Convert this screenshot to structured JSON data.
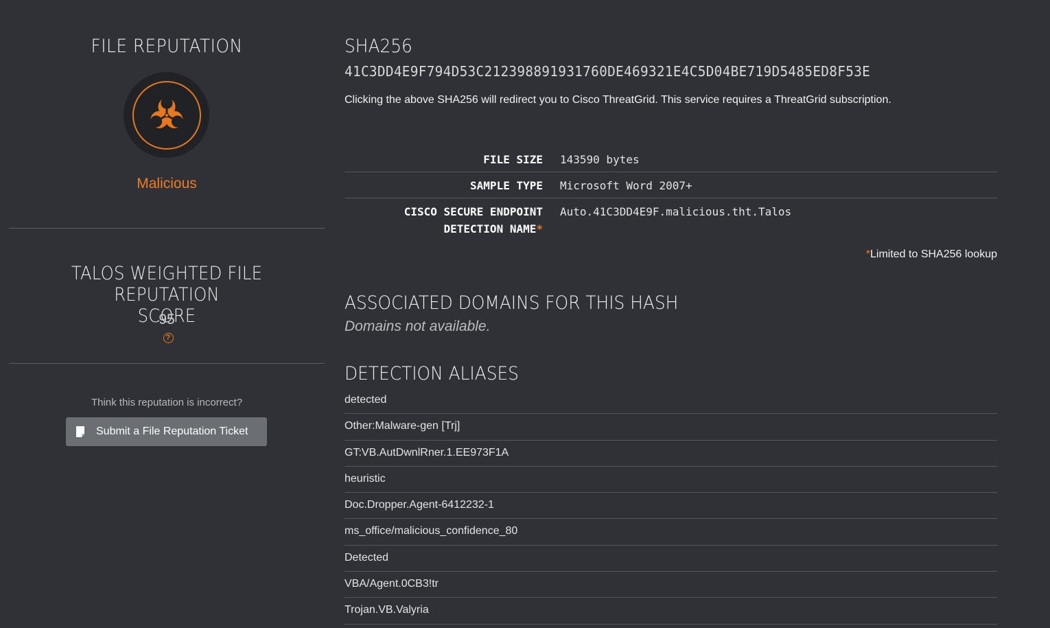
{
  "left": {
    "reputation_title": "FILE REPUTATION",
    "verdict": "Malicious",
    "score_title": "TALOS WEIGHTED FILE REPUTATION SCORE",
    "score_value": "95",
    "incorrect_prompt": "Think this reputation is incorrect?",
    "ticket_button_label": "Submit a File Reputation Ticket"
  },
  "right": {
    "sha_heading": "SHA256",
    "sha_value": "41C3DD4E9F794D53C212398891931760DE469321E4C5D04BE719D5485ED8F53E",
    "sha_note": "Clicking the above SHA256 will redirect you to Cisco ThreatGrid. This service requires a ThreatGrid subscription.",
    "file_info": [
      {
        "key": "FILE SIZE",
        "value": "143590 bytes"
      },
      {
        "key": "SAMPLE TYPE",
        "value": "Microsoft Word 2007+"
      },
      {
        "key": "CISCO SECURE ENDPOINT DETECTION NAME",
        "value": "Auto.41C3DD4E9F.malicious.tht.Talos"
      }
    ],
    "limited_note_marker": "*",
    "limited_note": "Limited to SHA256 lookup",
    "domains_heading": "ASSOCIATED DOMAINS FOR THIS HASH",
    "domains_empty": "Domains not available.",
    "aliases_heading": "DETECTION ALIASES",
    "aliases": [
      "detected",
      "Other:Malware-gen [Trj]",
      "GT:VB.AutDwnlRner.1.EE973F1A",
      "heuristic",
      "Doc.Dropper.Agent-6412232-1",
      "ms_office/malicious_confidence_80",
      "Detected",
      "VBA/Agent.0CB3!tr",
      "Trojan.VB.Valyria"
    ]
  },
  "colors": {
    "background": "#2f3136",
    "accent": "#e8781d",
    "button": "#6b6e73"
  },
  "icons": {
    "hazard": "biohazard-icon",
    "help": "question-circle-icon",
    "ticket": "document-icon"
  }
}
